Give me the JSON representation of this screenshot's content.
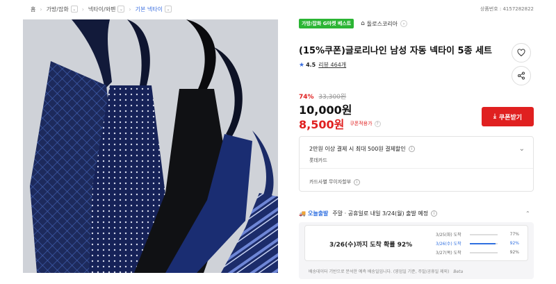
{
  "breadcrumb": [
    {
      "label": "홈",
      "dropdown": false
    },
    {
      "label": "가방/잡화",
      "dropdown": true
    },
    {
      "label": "넥타이/와펜",
      "dropdown": true
    },
    {
      "label": "기본 넥타이",
      "dropdown": true,
      "active": true
    }
  ],
  "product_no": "상품번호 : 4157282822",
  "badge": "가방/잡화 G마켓 베스트",
  "store": {
    "name": "돌로스코리아",
    "icon": "home-icon"
  },
  "title": "(15%쿠폰)글로리나인 남성 자동 넥타이 5종 세트",
  "rating": {
    "score": "4.5",
    "reviews": "리뷰 464개"
  },
  "discount": {
    "percent": "74%",
    "original": "33,300원"
  },
  "price": "10,000원",
  "coupon_price": {
    "price": "8,500원",
    "label": "쿠폰적용가"
  },
  "coupon_button": "쿠폰받기",
  "benefit": {
    "line1": "2만원 이상 결제 시 최대 500원 결제할인",
    "line2": "롯데카드",
    "line3": "카드사별 무이자할부"
  },
  "delivery": {
    "tag": "오늘출발",
    "text": "주말 · 공휴일로 내일 3/24(월) 출발 예정"
  },
  "forecast": {
    "headline": "3/26(수)까지 도착 확률 92%",
    "rows": [
      {
        "date": "3/25(화) 도착",
        "percent": "77%",
        "value": 77,
        "highlight": false
      },
      {
        "date": "3/26(수) 도착",
        "percent": "92%",
        "value": 92,
        "highlight": true
      },
      {
        "date": "3/27(목) 도착",
        "percent": "92%",
        "value": 92,
        "highlight": false
      }
    ],
    "note": "배송데이터 기반으로 분석한 예측 배송일입니다. (영업일 기준, 주말/공휴일 제외)",
    "beta": "Beta"
  },
  "colors": {
    "accent_red": "#e02020",
    "accent_blue": "#2f6fe0",
    "badge_green": "#2bb534"
  }
}
